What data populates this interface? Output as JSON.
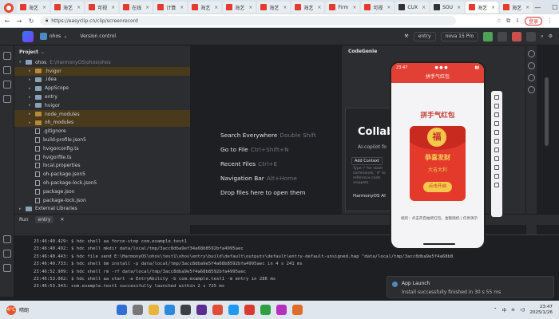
{
  "browser": {
    "tabs": [
      {
        "label": "海艺",
        "icon": "red"
      },
      {
        "label": "海艺",
        "icon": "red"
      },
      {
        "label": "可视",
        "icon": "red"
      },
      {
        "label": "在线",
        "icon": "red"
      },
      {
        "label": "计算",
        "icon": "red"
      },
      {
        "label": "海艺",
        "icon": "red"
      },
      {
        "label": "海艺",
        "icon": "red"
      },
      {
        "label": "海艺",
        "icon": "red"
      },
      {
        "label": "海艺",
        "icon": "red"
      },
      {
        "label": "Firm",
        "icon": "red"
      },
      {
        "label": "可视",
        "icon": "red"
      },
      {
        "label": "CUX",
        "icon": "dark"
      },
      {
        "label": "SOU",
        "icon": "dark"
      },
      {
        "label": "海艺",
        "icon": "red",
        "active": true
      },
      {
        "label": "海艺",
        "icon": "red"
      }
    ],
    "url": "https://easyclip.cn/clip/screenrecord",
    "profile": "登录"
  },
  "ide": {
    "project": "ohos",
    "version_control": "Version control",
    "module": "entry",
    "device": "nova 15 Pro",
    "panel_title": "Project",
    "tree": [
      {
        "indent": 0,
        "arrow": "▾",
        "kind": "folder",
        "label": "ohos",
        "sub": "E:\\HarmonyOS\\ohos\\ohos",
        "hl": false
      },
      {
        "indent": 1,
        "arrow": "▸",
        "kind": "folder-orange",
        "label": ".hvigor",
        "hl": true
      },
      {
        "indent": 1,
        "arrow": "▸",
        "kind": "folder",
        "label": ".idea",
        "hl": false
      },
      {
        "indent": 1,
        "arrow": "▸",
        "kind": "folder",
        "label": "AppScope",
        "hl": false
      },
      {
        "indent": 1,
        "arrow": "▸",
        "kind": "folder",
        "label": "entry",
        "hl": false
      },
      {
        "indent": 1,
        "arrow": "▸",
        "kind": "folder",
        "label": "hvigor",
        "hl": false
      },
      {
        "indent": 1,
        "arrow": "▸",
        "kind": "folder-orange",
        "label": "node_modules",
        "hl": true
      },
      {
        "indent": 1,
        "arrow": "▸",
        "kind": "folder-orange",
        "label": "oh_modules",
        "hl": true
      },
      {
        "indent": 1,
        "arrow": "",
        "kind": "file",
        "label": ".gitignore",
        "hl": false
      },
      {
        "indent": 1,
        "arrow": "",
        "kind": "file",
        "label": "build-profile.json5",
        "hl": false
      },
      {
        "indent": 1,
        "arrow": "",
        "kind": "file",
        "label": "hvigorconfig.ts",
        "hl": false
      },
      {
        "indent": 1,
        "arrow": "",
        "kind": "file",
        "label": "hvigorfile.ts",
        "hl": false
      },
      {
        "indent": 1,
        "arrow": "",
        "kind": "file",
        "label": "local.properties",
        "hl": false
      },
      {
        "indent": 1,
        "arrow": "",
        "kind": "file",
        "label": "oh-package.json5",
        "hl": false
      },
      {
        "indent": 1,
        "arrow": "",
        "kind": "file",
        "label": "oh-package-lock.json5",
        "hl": false
      },
      {
        "indent": 1,
        "arrow": "",
        "kind": "file",
        "label": "package.json",
        "hl": false
      },
      {
        "indent": 1,
        "arrow": "",
        "kind": "file",
        "label": "package-lock.json",
        "hl": false
      },
      {
        "indent": 0,
        "arrow": "▸",
        "kind": "folder",
        "label": "External Libraries",
        "hl": false
      }
    ],
    "run_label": "Run",
    "run_tab": "entry",
    "console": [
      "23:46:40.429: $ hdc shell aa force-stop com.example.test1",
      "23:46:40.492: $ hdc shell mkdir data/local/tmp/3acc8dba9ef34a68b8592bfa4995aec",
      "23:46:40.443: $ hdc file send E:\\HarmonyOS\\ohos\\test1\\ohos\\entry\\build\\default\\outputs\\default\\entry-default-unsigned.hap \"data/local/tmp/3acc8dba9e5f4a68b8",
      "23:46:40.733: $ hdc shell bm install -p data/local/tmp/3acc8dba9e5f4a68b8592bfa4995aec in 4 s 241 ms",
      "23:46:52.909: $ hdc shell rm -rf data/local/tmp/3acc8dba9e5f4a68b8592bfa4995aec",
      "23:46:53.062: $ hdc shell aa start -a EntryAbility -b com.example.test1 -m entry in 286 ms",
      "23:46:53.343: com.example.test1 successfully launched within 2 s 725 ms"
    ],
    "welcome": [
      {
        "label": "Search Everywhere",
        "shortcut": "Double Shift"
      },
      {
        "label": "Go to File",
        "shortcut": "Ctrl+Shift+N"
      },
      {
        "label": "Recent Files",
        "shortcut": "Ctrl+E"
      },
      {
        "label": "Navigation Bar",
        "shortcut": "Alt+Home"
      },
      {
        "label": "Drop files here to open them",
        "shortcut": ""
      }
    ]
  },
  "codegenie": {
    "title": "CodeGenie",
    "headline": "Collab",
    "subline": "AI-copilot fo",
    "add_context": "Add Context",
    "placeholder": "Type '/' for slash commands, '#' to reference code snippets",
    "model": "HarmonyOS AI"
  },
  "phone": {
    "time": "23:47",
    "header": "拼手气红包",
    "title": "拼手气红包",
    "coin": "福",
    "line1": "恭喜发财",
    "line2": "大吉大利",
    "open_button": "点击开启",
    "footer": "规则：点击开启抽奖红包，金额随机 | 仅供演示"
  },
  "notification": {
    "title": "App Launch",
    "message": "Install successfully finished in 30 s 55 ms"
  },
  "taskbar": {
    "weather_temp": "4°C",
    "weather_desc": "晴朗",
    "time": "23:47",
    "date": "2025/1/26",
    "lang": "中"
  },
  "colors": {
    "accent": "#e34035",
    "ide_bg": "#1e1f22",
    "panel_bg": "#2b2d30"
  }
}
